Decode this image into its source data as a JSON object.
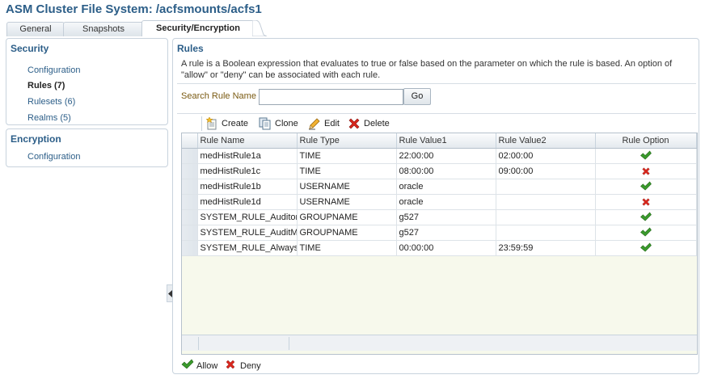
{
  "page": {
    "title": "ASM Cluster File System: /acfsmounts/acfs1"
  },
  "tabs": [
    {
      "label": "General"
    },
    {
      "label": "Snapshots"
    },
    {
      "label": "Security/Encryption",
      "active": true
    }
  ],
  "sidebar": {
    "security": {
      "header": "Security",
      "items": [
        {
          "label": "Configuration"
        },
        {
          "label": "Rules (7)",
          "selected": true
        },
        {
          "label": "Rulesets (6)"
        },
        {
          "label": "Realms (5)"
        }
      ]
    },
    "encryption": {
      "header": "Encryption",
      "items": [
        {
          "label": "Configuration"
        }
      ]
    }
  },
  "main": {
    "title": "Rules",
    "description": "A rule is a Boolean expression that evaluates to true or false based on the parameter on which the rule is based. An option of \"allow\" or \"deny\" can be associated with each rule.",
    "search": {
      "label": "Search Rule Name",
      "value": "",
      "go_label": "Go"
    },
    "toolbar": {
      "create": "Create",
      "clone": "Clone",
      "edit": "Edit",
      "delete": "Delete"
    },
    "table": {
      "columns": [
        "Rule Name",
        "Rule Type",
        "Rule Value1",
        "Rule Value2",
        "Rule Option"
      ],
      "rows": [
        {
          "name": "medHistRule1a",
          "type": "TIME",
          "value1": "22:00:00",
          "value2": "02:00:00",
          "option": "allow"
        },
        {
          "name": "medHistRule1c",
          "type": "TIME",
          "value1": "08:00:00",
          "value2": "09:00:00",
          "option": "deny"
        },
        {
          "name": "medHistRule1b",
          "type": "USERNAME",
          "value1": "oracle",
          "value2": "",
          "option": "allow"
        },
        {
          "name": "medHistRule1d",
          "type": "USERNAME",
          "value1": "oracle",
          "value2": "",
          "option": "deny"
        },
        {
          "name": "SYSTEM_RULE_Auditor",
          "type": "GROUPNAME",
          "value1": "g527",
          "value2": "",
          "option": "allow"
        },
        {
          "name": "SYSTEM_RULE_AuditMa",
          "type": "GROUPNAME",
          "value1": "g527",
          "value2": "",
          "option": "allow"
        },
        {
          "name": "SYSTEM_RULE_Always",
          "type": "TIME",
          "value1": "00:00:00",
          "value2": "23:59:59",
          "option": "allow"
        }
      ]
    },
    "legend": {
      "allow": "Allow",
      "deny": "Deny"
    }
  },
  "colors": {
    "accent": "#2c5e88",
    "allow": "#3a9a2c",
    "deny": "#d9261c",
    "table_filler": "#f7f9ec"
  },
  "icons": {
    "create": "create-icon",
    "clone": "clone-icon",
    "edit": "edit-pencil-icon",
    "delete": "delete-x-icon",
    "allow": "check-icon",
    "deny": "cross-icon",
    "collapse": "collapse-left-icon"
  }
}
